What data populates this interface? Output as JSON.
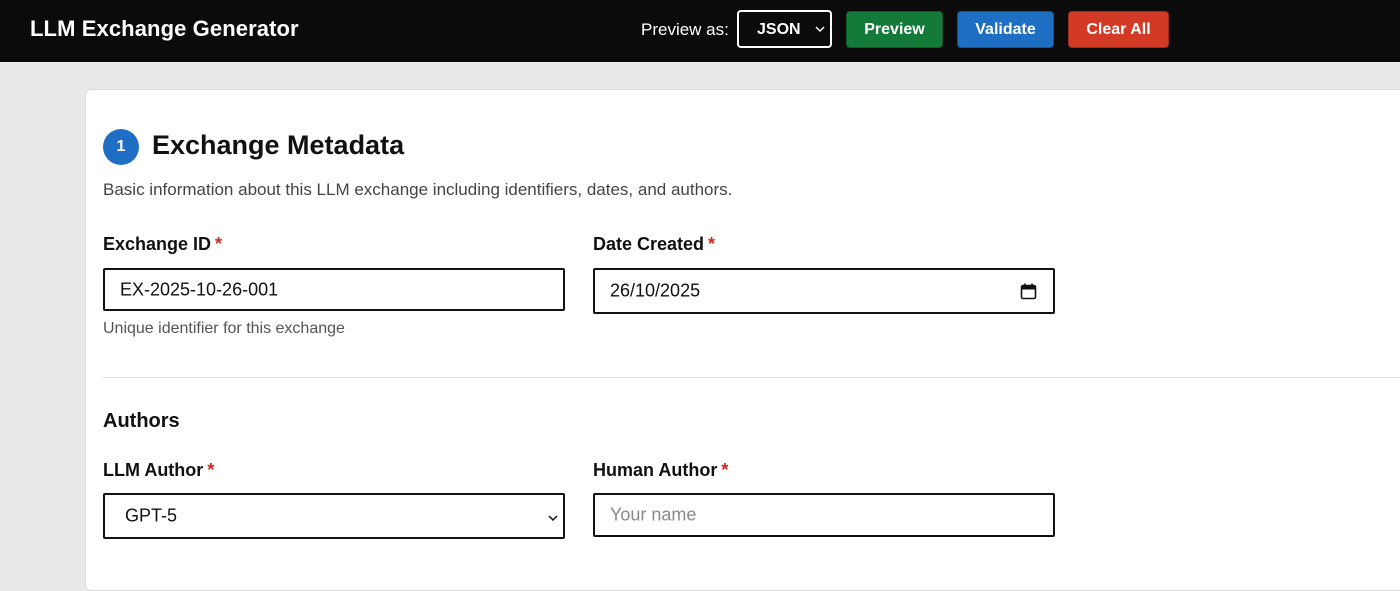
{
  "header": {
    "app_title": "LLM Exchange Generator",
    "preview_as_label": "Preview as:",
    "preview_format": "JSON",
    "preview_button": "Preview",
    "validate_button": "Validate",
    "clear_all_button": "Clear All"
  },
  "colors": {
    "preview": "#137a3a",
    "validate": "#1e6fc3",
    "clear_all": "#d23a26",
    "accent": "#1e6fc3",
    "required": "#c8281e"
  },
  "section": {
    "step_number": "1",
    "title": "Exchange Metadata",
    "description": "Basic information about this LLM exchange including identifiers, dates, and authors."
  },
  "fields": {
    "exchange_id": {
      "label": "Exchange ID",
      "required_mark": "*",
      "value": "EX-2025-10-26-001",
      "help": "Unique identifier for this exchange"
    },
    "date_created": {
      "label": "Date Created",
      "required_mark": "*",
      "value": "26/10/2025",
      "icon": "calendar-icon"
    }
  },
  "authors": {
    "title": "Authors",
    "llm_author": {
      "label": "LLM Author",
      "required_mark": "*",
      "value": "GPT-5"
    },
    "human_author": {
      "label": "Human Author",
      "required_mark": "*",
      "placeholder": "Your name"
    }
  }
}
